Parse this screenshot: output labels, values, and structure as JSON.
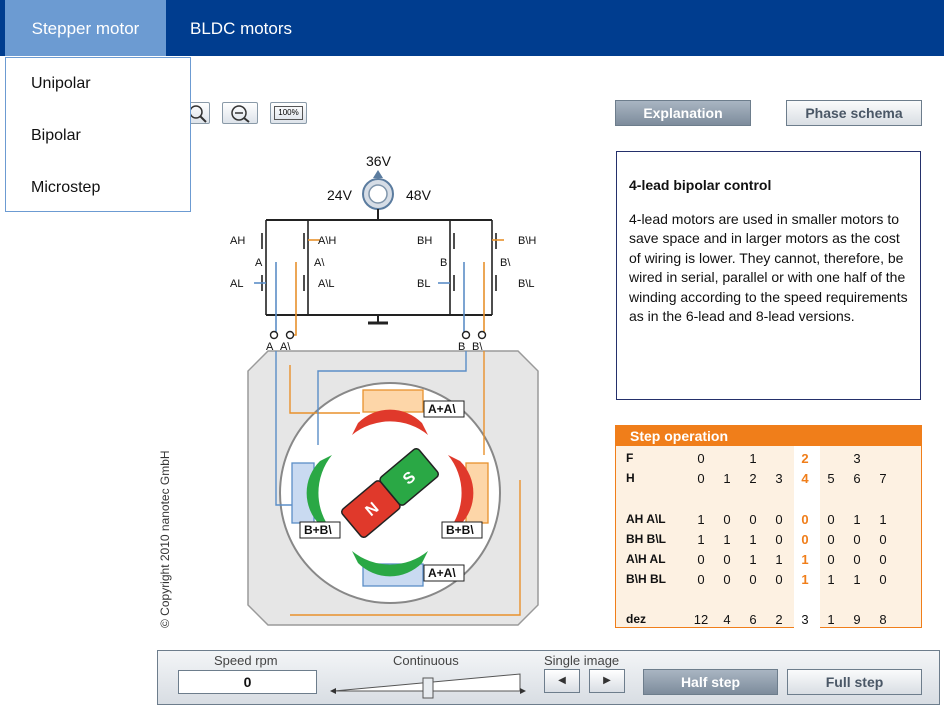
{
  "nav": {
    "tabs": [
      "Stepper motor",
      "BLDC motors"
    ]
  },
  "dropdown": {
    "items": [
      "Unipolar",
      "Bipolar",
      "Microstep"
    ]
  },
  "toolbar": {
    "zoom_100_label": "100%"
  },
  "panel_buttons": {
    "explanation": "Explanation",
    "phase_schema": "Phase schema"
  },
  "voltage": {
    "v36": "36V",
    "v24": "24V",
    "v48": "48V"
  },
  "circuit": {
    "transistors": [
      "AH",
      "A\\H",
      "BH",
      "B\\H",
      "AL",
      "A\\L",
      "BL",
      "B\\L"
    ],
    "phases": [
      "A",
      "A\\",
      "B",
      "B\\"
    ],
    "terminals": [
      "A",
      "A\\",
      "B",
      "B\\"
    ]
  },
  "motor": {
    "coil_labels": [
      "A+A\\",
      "B+B\\",
      "B+B\\",
      "A+A\\"
    ],
    "rotor": {
      "north": "N",
      "south": "S"
    }
  },
  "explanation": {
    "title": "4-lead bipolar control",
    "body": "4-lead motors are used in smaller motors to save space and in larger motors as the cost of wiring is lower. They cannot, therefore, be wired in serial, parallel or with one half of the winding according to the speed requirements as in the 6-lead and 8-lead versions."
  },
  "copyright": "© Copyright 2010 nanotec GmbH",
  "step_table": {
    "title": "Step operation",
    "row_labels": [
      "F",
      "H",
      "AH A\\L",
      "BH B\\L",
      "A\\H AL",
      "B\\H BL",
      "dez"
    ],
    "f_values": [
      "0",
      "",
      "1",
      "",
      "2",
      "",
      "3",
      ""
    ],
    "h_values": [
      "0",
      "1",
      "2",
      "3",
      "4",
      "5",
      "6",
      "7"
    ],
    "ah": [
      "1",
      "0",
      "0",
      "0",
      "0",
      "0",
      "1",
      "1"
    ],
    "bh": [
      "1",
      "1",
      "1",
      "0",
      "0",
      "0",
      "0",
      "0"
    ],
    "a_h": [
      "0",
      "0",
      "1",
      "1",
      "1",
      "0",
      "0",
      "0"
    ],
    "b_h": [
      "0",
      "0",
      "0",
      "0",
      "1",
      "1",
      "1",
      "0"
    ],
    "dez": [
      "12",
      "4",
      "6",
      "2",
      "3",
      "1",
      "9",
      "8"
    ],
    "highlight_column": 4
  },
  "controls": {
    "speed_label": "Speed rpm",
    "speed_value": "0",
    "continuous_label": "Continuous",
    "single_image_label": "Single image",
    "half_step": "Half step",
    "full_step": "Full step"
  },
  "colors": {
    "nav_bg": "#003d8f",
    "nav_active": "#6c9bd2",
    "accent_orange": "#f07e1a",
    "phase_blue": "#5b8ec7",
    "pole_red": "#e0392b",
    "pole_green": "#2aa845"
  }
}
